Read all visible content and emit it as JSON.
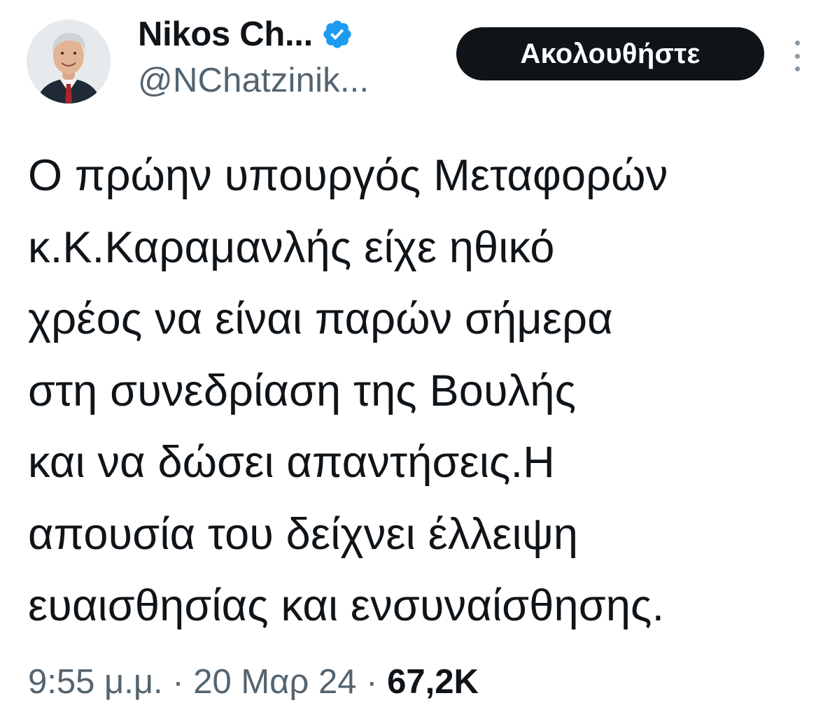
{
  "author": {
    "display_name": "Nikos Ch...",
    "handle": "@NChatzinik...",
    "verified_icon": "verified-badge-icon",
    "avatar_icon": "profile-photo"
  },
  "actions": {
    "follow_label": "Ακολουθήστε",
    "more_icon": "more-vertical-icon"
  },
  "tweet": {
    "text_lines": [
      "Ο πρώην υπουργός Μεταφορών",
      "κ.Κ.Καραμανλής είχε ηθικό",
      "χρέος να είναι παρών σήμερα",
      "στη συνεδρίαση της Βουλής",
      "και να δώσει απαντήσεις.Η",
      "απουσία του δείχνει έλλειψη",
      "ευαισθησίας και ενσυναίσθησης."
    ]
  },
  "meta": {
    "time": "9:55 μ.μ.",
    "separator": "·",
    "date": "20 Μαρ 24",
    "views": "67,2K"
  },
  "colors": {
    "text_primary": "#0f1419",
    "text_secondary": "#536471",
    "verified_blue": "#1d9bf0",
    "button_bg": "#0f1419"
  }
}
